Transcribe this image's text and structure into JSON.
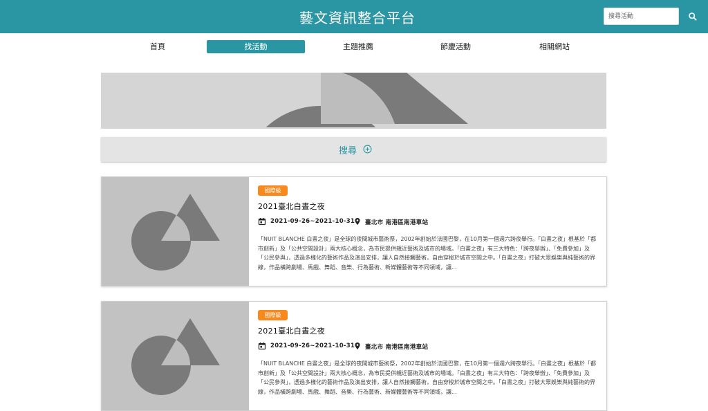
{
  "header": {
    "title": "藝文資訊整合平台",
    "search_placeholder": "搜尋活動"
  },
  "nav": {
    "items": [
      {
        "label": "首頁",
        "active": false
      },
      {
        "label": "找活動",
        "active": true
      },
      {
        "label": "主題推薦",
        "active": false
      },
      {
        "label": "節慶活動",
        "active": false
      },
      {
        "label": "相關網站",
        "active": false
      }
    ]
  },
  "filter": {
    "label": "搜尋",
    "icon": "plus-circle-icon"
  },
  "cards": [
    {
      "badge": "國際級",
      "title": "2021臺北白晝之夜",
      "date": "2021-09-26~2021-10-31",
      "location": "臺北市 南港區南港車站",
      "description": "「NUIT BLANCHE 白晝之夜」是全球的夜間城市藝術祭，2002年創始於法國巴黎，在10月第一個週六跨夜舉行。「白晝之夜」根基於「都市創新」及「公共空間設計」兩大核心概念，為市民提供親近藝術及城市的場域。「白晝之夜」有三大特色：「跨夜舉辦」、「免費參加」及「公民參與」，透過多樣化的藝術作品及演出安排，讓人自然接觸藝術，自由穿梭於城市空間之中。「白晝之夜」打破大眾娛樂與純藝術的界線，作品橫跨劇場、馬戲、舞蹈、音樂、行為藝術、新媒體藝術等不同領域，讓..."
    },
    {
      "badge": "國際級",
      "title": "2021臺北白晝之夜",
      "date": "2021-09-26~2021-10-31",
      "location": "臺北市 南港區南港車站",
      "description": "「NUIT BLANCHE 白晝之夜」是全球的夜間城市藝術祭，2002年創始於法國巴黎，在10月第一個週六跨夜舉行。「白晝之夜」根基於「都市創新」及「公共空間設計」兩大核心概念，為市民提供親近藝術及城市的場域。「白晝之夜」有三大特色：「跨夜舉辦」、「免費參加」及「公民參與」，透過多樣化的藝術作品及演出安排，讓人自然接觸藝術，自由穿梭於城市空間之中。「白晝之夜」打破大眾娛樂與純藝術的界線，作品橫跨劇場、馬戲、舞蹈、音樂、行為藝術、新媒體藝術等不同領域，讓..."
    }
  ],
  "colors": {
    "primary": "#2a96a3",
    "badge": "#f7891d"
  }
}
